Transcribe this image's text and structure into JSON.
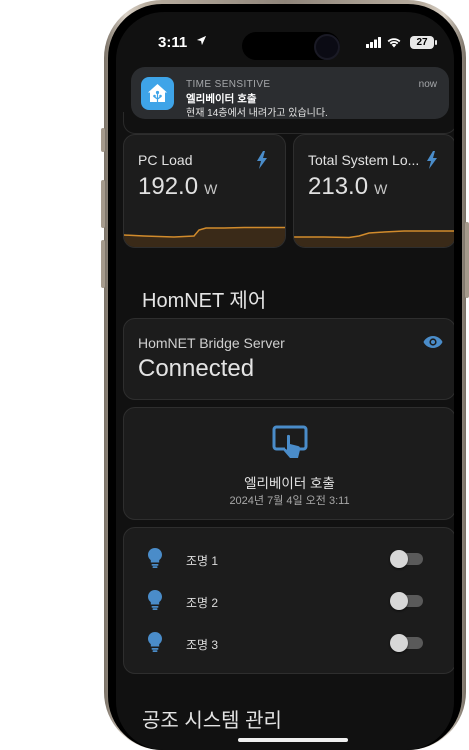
{
  "status_bar": {
    "time": "3:11",
    "battery": "27"
  },
  "notification": {
    "category": "TIME SENSITIVE",
    "time": "now",
    "title": "엘리베이터 호출",
    "body": "현재 14층에서 내려가고 있습니다."
  },
  "sensors": [
    {
      "name": "PC Load",
      "value": "192.0",
      "unit": "W"
    },
    {
      "name": "Total System Lo...",
      "value": "213.0",
      "unit": "W"
    }
  ],
  "homnet": {
    "section_title": "HomNET 제어",
    "bridge": {
      "name": "HomNET Bridge Server",
      "status": "Connected"
    },
    "elevator": {
      "name": "엘리베이터 호출",
      "timestamp": "2024년 7월 4일 오전 3:11"
    },
    "lights": [
      {
        "label": "조명 1",
        "on": false
      },
      {
        "label": "조명 2",
        "on": false
      },
      {
        "label": "조명 3",
        "on": false
      }
    ]
  },
  "hvac_section_title": "공조 시스템 관리",
  "colors": {
    "accent": "#4a8cc9",
    "sparkline": "#d18b2c",
    "card_bg": "#1c1c1c",
    "screen_bg": "#111111",
    "notif_icon_bg": "#3ea4e8"
  },
  "icons": [
    "location-arrow-icon",
    "signal-icon",
    "wifi-icon",
    "home-assistant-icon",
    "lightning-bolt-icon",
    "eye-icon",
    "gesture-tap-icon",
    "lightbulb-icon"
  ]
}
